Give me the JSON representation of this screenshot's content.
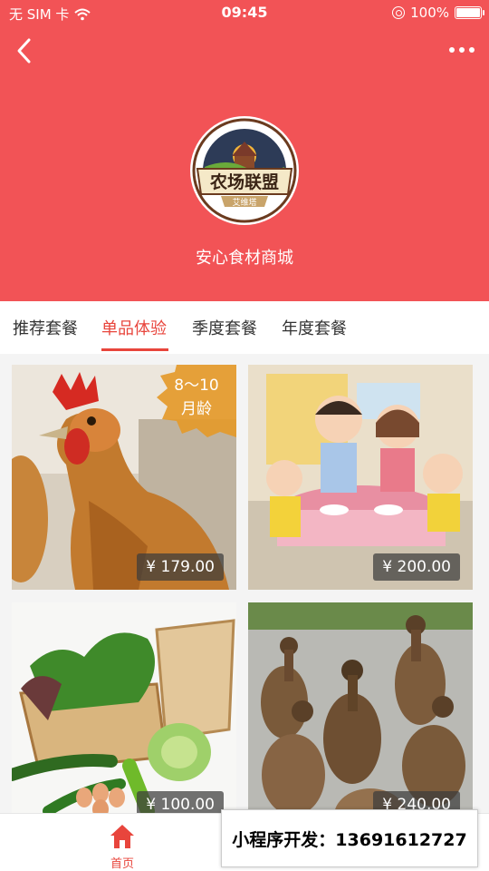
{
  "statusbar": {
    "carrier": "无 SIM 卡",
    "time": "09:45",
    "battery": "100%",
    "battery_level": 1.0
  },
  "nav": {
    "back_icon": "chevron-left-icon",
    "more_icon": "more-dots-icon"
  },
  "store": {
    "logo_text": "农场联盟",
    "logo_subtext": "艾维塔",
    "name": "安心食材商城"
  },
  "tabs": [
    {
      "label": "推荐套餐",
      "active": false
    },
    {
      "label": "单品体验",
      "active": true
    },
    {
      "label": "季度套餐",
      "active": false
    },
    {
      "label": "年度套餐",
      "active": false
    }
  ],
  "products": [
    {
      "image": "chicken",
      "price": "¥ 179.00",
      "badge_line1": "8～10",
      "badge_line2": "月龄"
    },
    {
      "image": "family-dining-figurines",
      "price": "¥ 200.00"
    },
    {
      "image": "vegetable-basket",
      "price": "¥ 100.00"
    },
    {
      "image": "ducks",
      "price": "¥ 240.00"
    }
  ],
  "bottom_nav": {
    "home_label": "首页",
    "home_icon": "home-icon"
  },
  "ad": {
    "text": "小程序开发：13691612727"
  },
  "colors": {
    "brand": "#f25356",
    "accent": "#e8453c"
  }
}
